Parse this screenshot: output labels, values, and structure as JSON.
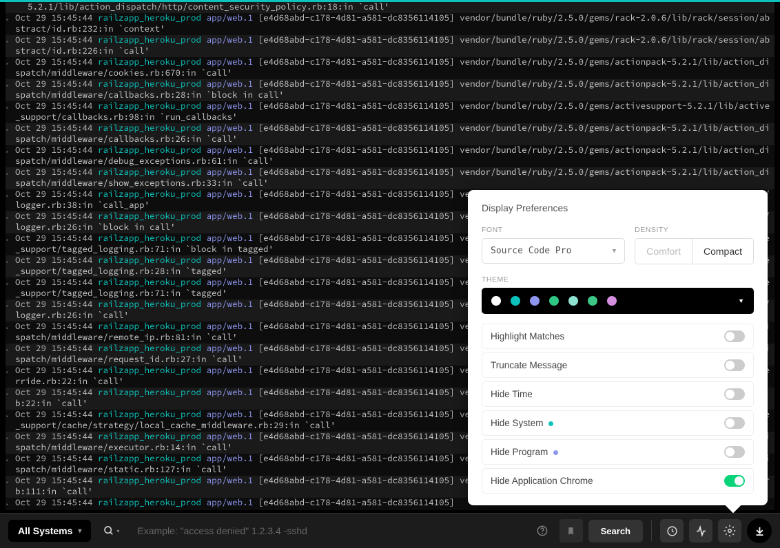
{
  "top_partial": "5.2.1/lib/action_dispatch/http/content_security_policy.rb:18:in `call'",
  "logs": [
    {
      "ts": "Oct 29 15:45:44",
      "sys": "railzapp_heroku_prod",
      "prog": "app/web.1",
      "brk": "[e4d68abd-c178-4d81-a581-dc8356114105]",
      "msg": " vendor/bundle/ruby/2.5.0/gems/rack-2.0.6/lib/rack/session/abstract/id.rb:232:in `context'"
    },
    {
      "ts": "Oct 29 15:45:44",
      "sys": "railzapp_heroku_prod",
      "prog": "app/web.1",
      "brk": "[e4d68abd-c178-4d81-a581-dc8356114105]",
      "msg": " vendor/bundle/ruby/2.5.0/gems/rack-2.0.6/lib/rack/session/abstract/id.rb:226:in `call'"
    },
    {
      "ts": "Oct 29 15:45:44",
      "sys": "railzapp_heroku_prod",
      "prog": "app/web.1",
      "brk": "[e4d68abd-c178-4d81-a581-dc8356114105]",
      "msg": " vendor/bundle/ruby/2.5.0/gems/actionpack-5.2.1/lib/action_dispatch/middleware/cookies.rb:670:in `call'"
    },
    {
      "ts": "Oct 29 15:45:44",
      "sys": "railzapp_heroku_prod",
      "prog": "app/web.1",
      "brk": "[e4d68abd-c178-4d81-a581-dc8356114105]",
      "msg": " vendor/bundle/ruby/2.5.0/gems/actionpack-5.2.1/lib/action_dispatch/middleware/callbacks.rb:28:in `block in call'"
    },
    {
      "ts": "Oct 29 15:45:44",
      "sys": "railzapp_heroku_prod",
      "prog": "app/web.1",
      "brk": "[e4d68abd-c178-4d81-a581-dc8356114105]",
      "msg": " vendor/bundle/ruby/2.5.0/gems/activesupport-5.2.1/lib/active_support/callbacks.rb:98:in `run_callbacks'"
    },
    {
      "ts": "Oct 29 15:45:44",
      "sys": "railzapp_heroku_prod",
      "prog": "app/web.1",
      "brk": "[e4d68abd-c178-4d81-a581-dc8356114105]",
      "msg": " vendor/bundle/ruby/2.5.0/gems/actionpack-5.2.1/lib/action_dispatch/middleware/callbacks.rb:26:in `call'"
    },
    {
      "ts": "Oct 29 15:45:44",
      "sys": "railzapp_heroku_prod",
      "prog": "app/web.1",
      "brk": "[e4d68abd-c178-4d81-a581-dc8356114105]",
      "msg": " vendor/bundle/ruby/2.5.0/gems/actionpack-5.2.1/lib/action_dispatch/middleware/debug_exceptions.rb:61:in `call'"
    },
    {
      "ts": "Oct 29 15:45:44",
      "sys": "railzapp_heroku_prod",
      "prog": "app/web.1",
      "brk": "[e4d68abd-c178-4d81-a581-dc8356114105]",
      "msg": " vendor/bundle/ruby/2.5.0/gems/actionpack-5.2.1/lib/action_dispatch/middleware/show_exceptions.rb:33:in `call'"
    },
    {
      "ts": "Oct 29 15:45:44",
      "sys": "railzapp_heroku_prod",
      "prog": "app/web.1",
      "brk": "[e4d68abd-c178-4d81-a581-dc8356114105]",
      "msg": " vendor/bundle/ruby/2.5.0/gems/railties-5.2.1/lib/rails/rack/logger.rb:38:in `call_app'"
    },
    {
      "ts": "Oct 29 15:45:44",
      "sys": "railzapp_heroku_prod",
      "prog": "app/web.1",
      "brk": "[e4d68abd-c178-4d81-a581-dc8356114105]",
      "msg": " vendor/bundle/ruby/2.5.0/gems/railties-5.2.1/lib/rails/rack/logger.rb:26:in `block in call'"
    },
    {
      "ts": "Oct 29 15:45:44",
      "sys": "railzapp_heroku_prod",
      "prog": "app/web.1",
      "brk": "[e4d68abd-c178-4d81-a581-dc8356114105]",
      "msg": " vendor/bundle/ruby/2.5.0/gems/activesupport-5.2.1/lib/active_support/tagged_logging.rb:71:in `block in tagged'"
    },
    {
      "ts": "Oct 29 15:45:44",
      "sys": "railzapp_heroku_prod",
      "prog": "app/web.1",
      "brk": "[e4d68abd-c178-4d81-a581-dc8356114105]",
      "msg": " vendor/bundle/ruby/2.5.0/gems/activesupport-5.2.1/lib/active_support/tagged_logging.rb:28:in `tagged'"
    },
    {
      "ts": "Oct 29 15:45:44",
      "sys": "railzapp_heroku_prod",
      "prog": "app/web.1",
      "brk": "[e4d68abd-c178-4d81-a581-dc8356114105]",
      "msg": " vendor/bundle/ruby/2.5.0/gems/activesupport-5.2.1/lib/active_support/tagged_logging.rb:71:in `tagged'"
    },
    {
      "ts": "Oct 29 15:45:44",
      "sys": "railzapp_heroku_prod",
      "prog": "app/web.1",
      "brk": "[e4d68abd-c178-4d81-a581-dc8356114105]",
      "msg": " vendor/bundle/ruby/2.5.0/gems/railties-5.2.1/lib/rails/rack/logger.rb:26:in `call'"
    },
    {
      "ts": "Oct 29 15:45:44",
      "sys": "railzapp_heroku_prod",
      "prog": "app/web.1",
      "brk": "[e4d68abd-c178-4d81-a581-dc8356114105]",
      "msg": " vendor/bundle/ruby/2.5.0/gems/actionpack-5.2.1/lib/action_dispatch/middleware/remote_ip.rb:81:in `call'"
    },
    {
      "ts": "Oct 29 15:45:44",
      "sys": "railzapp_heroku_prod",
      "prog": "app/web.1",
      "brk": "[e4d68abd-c178-4d81-a581-dc8356114105]",
      "msg": " vendor/bundle/ruby/2.5.0/gems/actionpack-5.2.1/lib/action_dispatch/middleware/request_id.rb:27:in `call'"
    },
    {
      "ts": "Oct 29 15:45:44",
      "sys": "railzapp_heroku_prod",
      "prog": "app/web.1",
      "brk": "[e4d68abd-c178-4d81-a581-dc8356114105]",
      "msg": " vendor/bundle/ruby/2.5.0/gems/rack-2.0.6/lib/rack/method_override.rb:22:in `call'"
    },
    {
      "ts": "Oct 29 15:45:44",
      "sys": "railzapp_heroku_prod",
      "prog": "app/web.1",
      "brk": "[e4d68abd-c178-4d81-a581-dc8356114105]",
      "msg": " vendor/bundle/ruby/2.5.0/gems/rack-2.0.6/lib/rack/runtime.rb:22:in `call'"
    },
    {
      "ts": "Oct 29 15:45:44",
      "sys": "railzapp_heroku_prod",
      "prog": "app/web.1",
      "brk": "[e4d68abd-c178-4d81-a581-dc8356114105]",
      "msg": " vendor/bundle/ruby/2.5.0/gems/activesupport-5.2.1/lib/active_support/cache/strategy/local_cache_middleware.rb:29:in `call'"
    },
    {
      "ts": "Oct 29 15:45:44",
      "sys": "railzapp_heroku_prod",
      "prog": "app/web.1",
      "brk": "[e4d68abd-c178-4d81-a581-dc8356114105]",
      "msg": " vendor/bundle/ruby/2.5.0/gems/actionpack-5.2.1/lib/action_dispatch/middleware/executor.rb:14:in `call'"
    },
    {
      "ts": "Oct 29 15:45:44",
      "sys": "railzapp_heroku_prod",
      "prog": "app/web.1",
      "brk": "[e4d68abd-c178-4d81-a581-dc8356114105]",
      "msg": " vendor/bundle/ruby/2.5.0/gems/actionpack-5.2.1/lib/action_dispatch/middleware/static.rb:127:in `call'"
    },
    {
      "ts": "Oct 29 15:45:44",
      "sys": "railzapp_heroku_prod",
      "prog": "app/web.1",
      "brk": "[e4d68abd-c178-4d81-a581-dc8356114105]",
      "msg": " vendor/bundle/ruby/2.5.0/gems/rack-2.0.6/lib/rack/sendfile.rb:111:in `call'"
    },
    {
      "ts": "Oct 29 15:45:44",
      "sys": "railzapp_heroku_prod",
      "prog": "app/web.1",
      "brk": "[e4d68abd-c178-4d81-a581-dc8356114105]",
      "msg": ""
    }
  ],
  "toolbar": {
    "systems_label": "All Systems",
    "search_placeholder": "Example: \"access denied\" 1.2.3.4 -sshd",
    "search_btn": "Search"
  },
  "prefs": {
    "title": "Display Preferences",
    "font_label": "FONT",
    "font_value": "Source Code Pro",
    "density_label": "DENSITY",
    "density_comfort": "Comfort",
    "density_compact": "Compact",
    "theme_label": "THEME",
    "theme_swatches": [
      "#ffffff",
      "#0cc3bc",
      "#8e96f0",
      "#2ec785",
      "#8de2d0",
      "#3cc786",
      "#d58ee0"
    ],
    "toggles": [
      {
        "label": "Highlight Matches",
        "on": false
      },
      {
        "label": "Truncate Message",
        "on": false
      },
      {
        "label": "Hide Time",
        "on": false
      },
      {
        "label": "Hide System",
        "on": false,
        "dot": "#0cc3bc"
      },
      {
        "label": "Hide Program",
        "on": false,
        "dot": "#8e96f0"
      },
      {
        "label": "Hide Application Chrome",
        "on": true
      }
    ]
  }
}
